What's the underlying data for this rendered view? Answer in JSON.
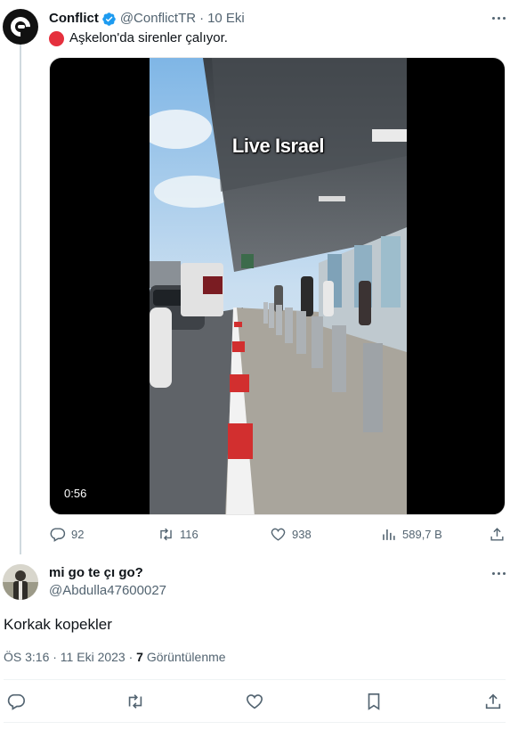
{
  "tweet": {
    "author_name": "Conflict",
    "handle": "@ConflictTR",
    "separator": "·",
    "date": "10 Eki",
    "text": "Aşkelon'da sirenler çalıyor.",
    "video_overlay_text": "Live Israel",
    "video_duration": "0:56",
    "stats": {
      "replies": "92",
      "retweets": "116",
      "likes": "938",
      "views": "589,7 B"
    }
  },
  "reply": {
    "author_name": "mi go te çı go?",
    "handle": "@Abdulla47600027",
    "text": "Korkak kopekler",
    "timestamp": "ÖS 3:16 · 11 Eki 2023 · ",
    "views_count": "7",
    "views_label": " Görüntülenme"
  },
  "icons": [
    "verified-badge-icon",
    "more-icon",
    "reply-icon",
    "retweet-icon",
    "like-icon",
    "views-icon",
    "share-icon",
    "bookmark-icon"
  ],
  "colors": {
    "text": "#0f1419",
    "secondary": "#536471",
    "verified": "#1d9bf0",
    "red_dot": "#e5303d"
  }
}
